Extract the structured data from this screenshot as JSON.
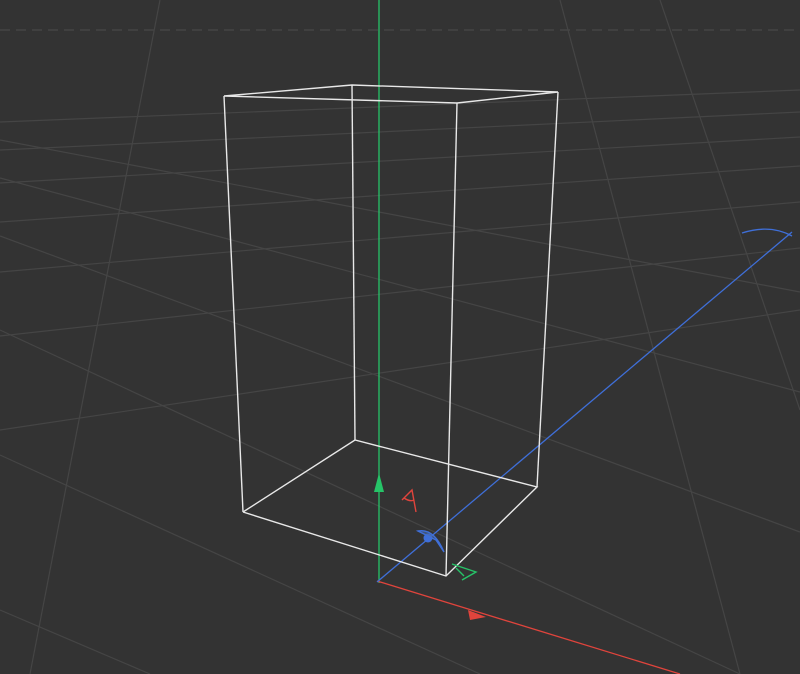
{
  "viewport": {
    "background": "#333333",
    "grid_color": "#454545",
    "grid_visible": true
  },
  "axes": {
    "x": {
      "color": "#e0443c"
    },
    "y": {
      "color": "#26c468"
    },
    "z": {
      "color": "#3f6fd8"
    }
  },
  "object": {
    "type": "box",
    "display": "wireframe",
    "selected": true,
    "wire_color": "#e8e8e8"
  },
  "gizmo": {
    "mode": "move",
    "icons": [
      "y-arrow-icon",
      "x-rotate-arc-icon",
      "z-rotate-arc-icon",
      "y-rotate-arc-icon"
    ]
  }
}
